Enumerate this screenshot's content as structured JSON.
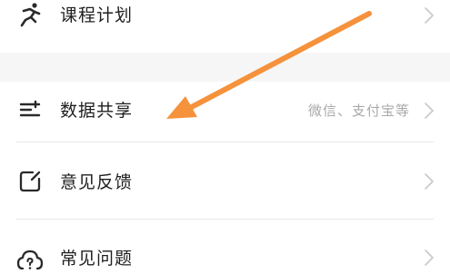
{
  "menu": {
    "items": [
      {
        "label": "课程计划",
        "value": "",
        "icon": "running-person-icon"
      },
      {
        "label": "数据共享",
        "value": "微信、支付宝等",
        "icon": "sliders-lines-icon"
      },
      {
        "label": "意见反馈",
        "value": "",
        "icon": "edit-square-icon"
      },
      {
        "label": "常见问题",
        "value": "",
        "icon": "help-cloud-icon"
      }
    ]
  },
  "annotation": {
    "arrow_color": "#F5923B",
    "arrow_target": "数据共享"
  }
}
